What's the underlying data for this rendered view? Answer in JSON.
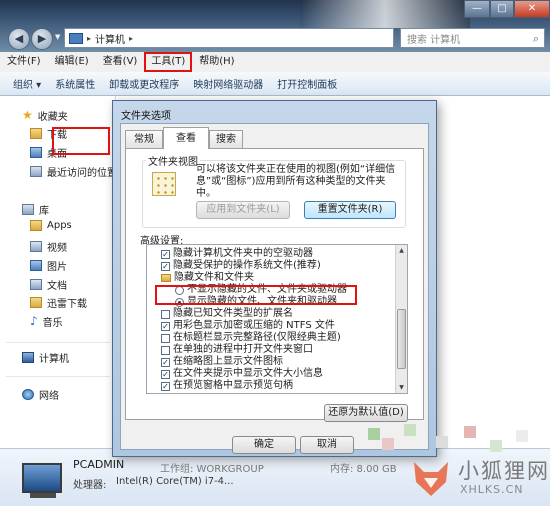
{
  "window": {
    "address_crumb": "计算机",
    "search_placeholder": "搜索 计算机",
    "controls": {
      "minimize": "—",
      "maximize": "□",
      "close": "✕"
    }
  },
  "menubar": {
    "items": [
      "文件(F)",
      "编辑(E)",
      "查看(V)",
      "工具(T)",
      "帮助(H)"
    ],
    "highlighted": "工具(T)"
  },
  "toolbar": {
    "items": [
      "组织 ▾",
      "系统属性",
      "卸载或更改程序",
      "映射网络驱动器",
      "打开控制面板"
    ]
  },
  "sidebar": {
    "favorites": {
      "label": "收藏夹",
      "items": [
        "下载",
        "桌面",
        "最近访问的位置"
      ]
    },
    "libraries": {
      "label": "库",
      "items": [
        "Apps",
        "视频",
        "图片",
        "文档",
        "迅雷下载",
        "音乐"
      ]
    },
    "computer": "计算机",
    "network": "网络"
  },
  "details": {
    "computer_name": "PCADMIN",
    "workgroup": "工作组: WORKGROUP",
    "processor_label": "处理器:",
    "processor_value": "Intel(R) Core(TM) i7-4...",
    "memory": "内存: 8.00 GB"
  },
  "dialog": {
    "title": "文件夹选项",
    "tabs": [
      "常规",
      "查看",
      "搜索"
    ],
    "active_tab": "查看",
    "folder_views_label": "文件夹视图",
    "folder_views_desc": "可以将该文件夹正在使用的视图(例如“详细信息”或“图标”)应用到所有这种类型的文件夹中。",
    "apply_button": "应用到文件夹(L)",
    "reset_button": "重置文件夹(R)",
    "advanced_label": "高级设置:",
    "advanced_items": [
      {
        "type": "checkbox",
        "checked": true,
        "label": "隐藏计算机文件夹中的空驱动器"
      },
      {
        "type": "checkbox",
        "checked": true,
        "label": "隐藏受保护的操作系统文件(推荐)"
      },
      {
        "type": "folder",
        "label": "隐藏文件和文件夹"
      },
      {
        "type": "radio",
        "checked": false,
        "label": "不显示隐藏的文件、文件夹或驱动器"
      },
      {
        "type": "radio",
        "checked": true,
        "label": "显示隐藏的文件、文件夹和驱动器"
      },
      {
        "type": "checkbox",
        "checked": false,
        "label": "隐藏已知文件类型的扩展名"
      },
      {
        "type": "checkbox",
        "checked": true,
        "label": "用彩色显示加密或压缩的 NTFS 文件"
      },
      {
        "type": "checkbox",
        "checked": false,
        "label": "在标题栏显示完整路径(仅限经典主题)"
      },
      {
        "type": "checkbox",
        "checked": false,
        "label": "在单独的进程中打开文件夹窗口"
      },
      {
        "type": "checkbox",
        "checked": true,
        "label": "在缩略图上显示文件图标"
      },
      {
        "type": "checkbox",
        "checked": true,
        "label": "在文件夹提示中显示文件大小信息"
      },
      {
        "type": "checkbox",
        "checked": true,
        "label": "在预览窗格中显示预览句柄"
      }
    ],
    "restore_button": "还原为默认值(D)",
    "ok_button": "确定",
    "cancel_button": "取消"
  },
  "watermark": {
    "cn": "小狐狸网",
    "en": "XHLKS.CN"
  },
  "colors": {
    "highlight_red": "#e01212",
    "watermark_fox": "#e8603c"
  }
}
